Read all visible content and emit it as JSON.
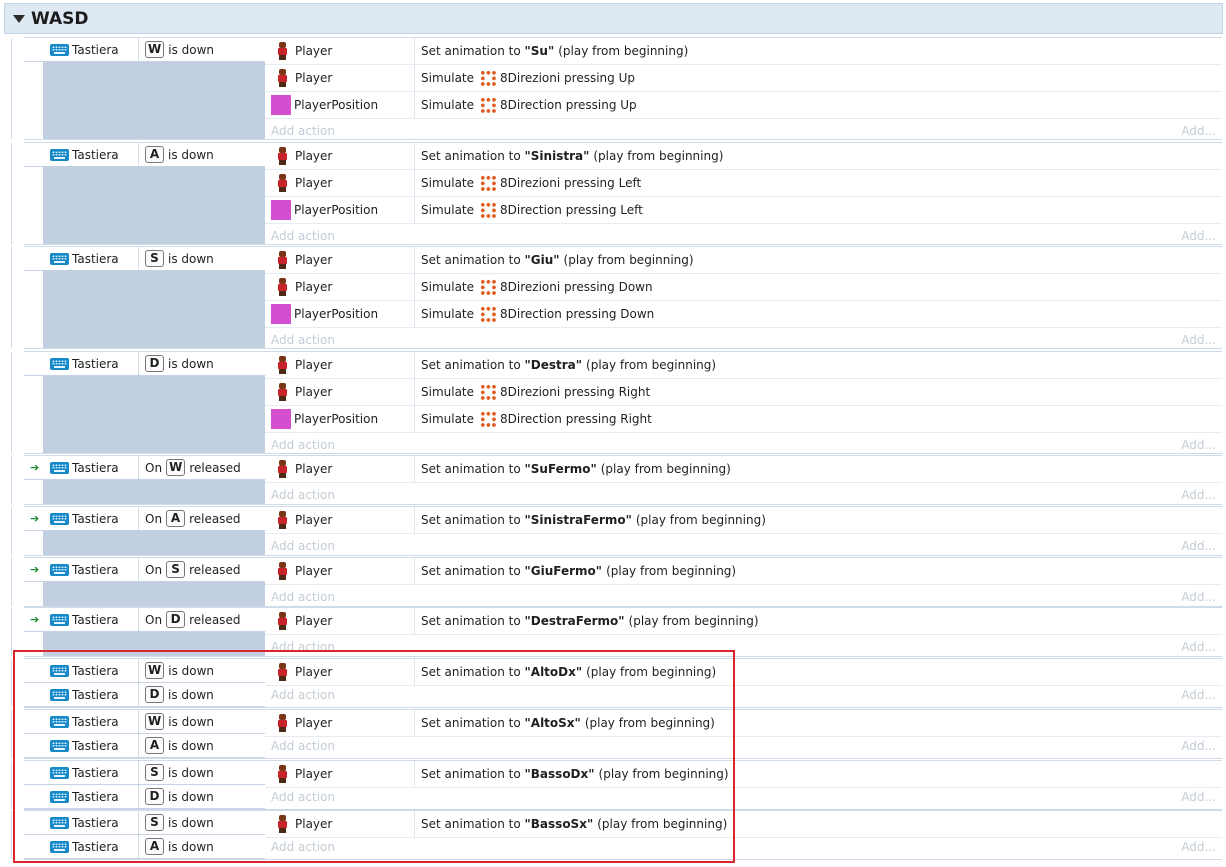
{
  "group": {
    "title": "WASD"
  },
  "add_action_label": "Add action",
  "add_right_label": "Add...",
  "events": [
    {
      "conditions": [
        {
          "object": "Tastiera",
          "prefix": "",
          "key": "W",
          "suffix": "is down",
          "trigger": false
        }
      ],
      "actions": [
        {
          "object": "Player",
          "icon": "player",
          "pre": "Set animation to",
          "bold": "\"Su\"",
          "post": "(play from beginning)"
        },
        {
          "object": "Player",
          "icon": "player",
          "pre": "Simulate",
          "behavior": "8Direzioni",
          "post": "pressing Up"
        },
        {
          "object": "PlayerPosition",
          "icon": "position",
          "pre": "Simulate",
          "behavior": "8Direction",
          "post": "pressing Up"
        }
      ]
    },
    {
      "conditions": [
        {
          "object": "Tastiera",
          "prefix": "",
          "key": "A",
          "suffix": "is down",
          "trigger": false
        }
      ],
      "actions": [
        {
          "object": "Player",
          "icon": "player",
          "pre": "Set animation to",
          "bold": "\"Sinistra\"",
          "post": "(play from beginning)"
        },
        {
          "object": "Player",
          "icon": "player",
          "pre": "Simulate",
          "behavior": "8Direzioni",
          "post": "pressing Left"
        },
        {
          "object": "PlayerPosition",
          "icon": "position",
          "pre": "Simulate",
          "behavior": "8Direction",
          "post": "pressing Left"
        }
      ]
    },
    {
      "conditions": [
        {
          "object": "Tastiera",
          "prefix": "",
          "key": "S",
          "suffix": "is down",
          "trigger": false
        }
      ],
      "actions": [
        {
          "object": "Player",
          "icon": "player",
          "pre": "Set animation to",
          "bold": "\"Giu\"",
          "post": "(play from beginning)"
        },
        {
          "object": "Player",
          "icon": "player",
          "pre": "Simulate",
          "behavior": "8Direzioni",
          "post": "pressing Down"
        },
        {
          "object": "PlayerPosition",
          "icon": "position",
          "pre": "Simulate",
          "behavior": "8Direction",
          "post": "pressing Down"
        }
      ]
    },
    {
      "conditions": [
        {
          "object": "Tastiera",
          "prefix": "",
          "key": "D",
          "suffix": "is down",
          "trigger": false
        }
      ],
      "actions": [
        {
          "object": "Player",
          "icon": "player",
          "pre": "Set animation to",
          "bold": "\"Destra\"",
          "post": "(play from beginning)"
        },
        {
          "object": "Player",
          "icon": "player",
          "pre": "Simulate",
          "behavior": "8Direzioni",
          "post": "pressing Right"
        },
        {
          "object": "PlayerPosition",
          "icon": "position",
          "pre": "Simulate",
          "behavior": "8Direction",
          "post": "pressing Right"
        }
      ]
    },
    {
      "conditions": [
        {
          "object": "Tastiera",
          "prefix": "On",
          "key": "W",
          "suffix": "released",
          "trigger": true
        }
      ],
      "actions": [
        {
          "object": "Player",
          "icon": "player",
          "pre": "Set animation to",
          "bold": "\"SuFermo\"",
          "post": "(play from beginning)"
        }
      ]
    },
    {
      "conditions": [
        {
          "object": "Tastiera",
          "prefix": "On",
          "key": "A",
          "suffix": "released",
          "trigger": true
        }
      ],
      "actions": [
        {
          "object": "Player",
          "icon": "player",
          "pre": "Set animation to",
          "bold": "\"SinistraFermo\"",
          "post": "(play from beginning)"
        }
      ]
    },
    {
      "conditions": [
        {
          "object": "Tastiera",
          "prefix": "On",
          "key": "S",
          "suffix": "released",
          "trigger": true
        }
      ],
      "actions": [
        {
          "object": "Player",
          "icon": "player",
          "pre": "Set animation to",
          "bold": "\"GiuFermo\"",
          "post": "(play from beginning)"
        }
      ]
    },
    {
      "conditions": [
        {
          "object": "Tastiera",
          "prefix": "On",
          "key": "D",
          "suffix": "released",
          "trigger": true
        }
      ],
      "actions": [
        {
          "object": "Player",
          "icon": "player",
          "pre": "Set animation to",
          "bold": "\"DestraFermo\"",
          "post": "(play from beginning)"
        }
      ]
    },
    {
      "conditions": [
        {
          "object": "Tastiera",
          "prefix": "",
          "key": "W",
          "suffix": "is down",
          "trigger": false
        },
        {
          "object": "Tastiera",
          "prefix": "",
          "key": "D",
          "suffix": "is down",
          "trigger": false
        }
      ],
      "actions": [
        {
          "object": "Player",
          "icon": "player",
          "pre": "Set animation to",
          "bold": "\"AltoDx\"",
          "post": "(play from beginning)"
        }
      ]
    },
    {
      "conditions": [
        {
          "object": "Tastiera",
          "prefix": "",
          "key": "W",
          "suffix": "is down",
          "trigger": false
        },
        {
          "object": "Tastiera",
          "prefix": "",
          "key": "A",
          "suffix": "is down",
          "trigger": false
        }
      ],
      "actions": [
        {
          "object": "Player",
          "icon": "player",
          "pre": "Set animation to",
          "bold": "\"AltoSx\"",
          "post": "(play from beginning)"
        }
      ]
    },
    {
      "conditions": [
        {
          "object": "Tastiera",
          "prefix": "",
          "key": "S",
          "suffix": "is down",
          "trigger": false
        },
        {
          "object": "Tastiera",
          "prefix": "",
          "key": "D",
          "suffix": "is down",
          "trigger": false
        }
      ],
      "actions": [
        {
          "object": "Player",
          "icon": "player",
          "pre": "Set animation to",
          "bold": "\"BassoDx\"",
          "post": "(play from beginning)"
        }
      ]
    },
    {
      "conditions": [
        {
          "object": "Tastiera",
          "prefix": "",
          "key": "S",
          "suffix": "is down",
          "trigger": false
        },
        {
          "object": "Tastiera",
          "prefix": "",
          "key": "A",
          "suffix": "is down",
          "trigger": false
        }
      ],
      "actions": [
        {
          "object": "Player",
          "icon": "player",
          "pre": "Set animation to",
          "bold": "\"BassoSx\"",
          "post": "(play from beginning)"
        }
      ]
    }
  ]
}
